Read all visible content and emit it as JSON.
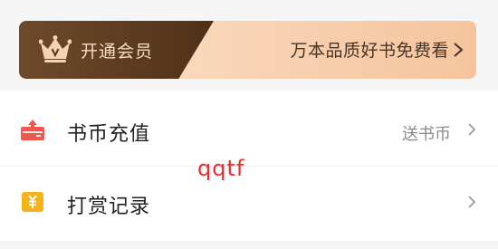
{
  "vip": {
    "title": "开通会员",
    "promo": "万本品质好书免费看",
    "crown_icon": "crown-icon",
    "arrow_icon": "chevron-right-icon"
  },
  "menu": [
    {
      "label": "书币充值",
      "sub": "送书币",
      "icon": "recharge-box-icon",
      "chevron": "chevron-right-icon"
    },
    {
      "label": "打赏记录",
      "sub": "",
      "icon": "yuan-coin-icon",
      "chevron": "chevron-right-icon"
    }
  ],
  "watermark": "qqtf",
  "colors": {
    "banner_dark": "#5a3a20",
    "banner_light": "#f5c49d",
    "recharge_icon": "#f0574e",
    "reward_icon": "#f5b31b",
    "watermark": "#ef2a2a"
  }
}
